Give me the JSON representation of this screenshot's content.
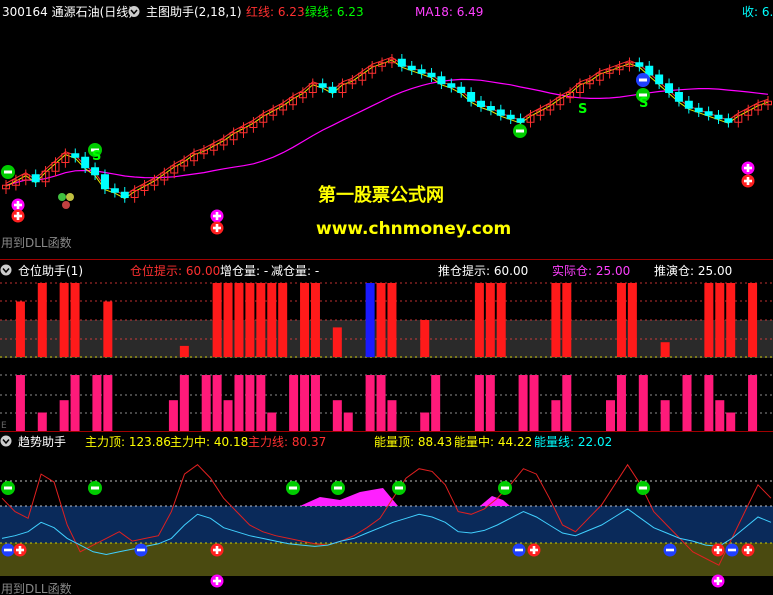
{
  "main": {
    "stock": "300164 通源石油(日线)",
    "indicator": "主图助手(2,18,1)",
    "red_line_label": "红线: 6.23",
    "green_line_label": "绿线: 6.23",
    "ma_label": "MA18: 6.49",
    "close_label": "收: 6.",
    "watermark_title": "第一股票公式网",
    "watermark_url": "www.chnmoney.com",
    "dll_note": "用到DLL函数",
    "signal_s": "S"
  },
  "panel2": {
    "title": "仓位助手(1)",
    "p1": "仓位提示: 60.00",
    "p2": "增仓量: -",
    "p3": "减仓量: -",
    "p4": "推仓提示: 60.00",
    "p5": "实际仓: 25.00",
    "p6": "推演仓: 25.00",
    "corner_char": "E"
  },
  "panel3": {
    "title": "趋势助手",
    "p1": "主力顶: 123.86",
    "p2": "主力中: 40.18",
    "p3": "主力线: 80.37",
    "p4": "能量顶: 88.43",
    "p5": "能量中: 44.22",
    "p6": "能量线: 22.02",
    "dll_note": "用到DLL函数"
  },
  "colors": {
    "up": "#ff3030",
    "down": "#00ffff",
    "ma": "#ff00ff",
    "green_line": "#e8e800",
    "bar_red": "#ff1a1a",
    "bar_pink": "#ff1a7a",
    "label_yellow": "#ffff00",
    "label_white": "#ffffff",
    "label_red": "#ff3030",
    "label_green": "#00ff00",
    "label_magenta": "#ff40ff",
    "label_cyan": "#00ffff"
  },
  "chart_data": [
    {
      "type": "candlestick",
      "note": "price panel, values estimated",
      "close": [
        6.02,
        6.05,
        6.08,
        6.04,
        6.1,
        6.15,
        6.2,
        6.18,
        6.12,
        6.08,
        6.0,
        5.98,
        5.95,
        5.99,
        6.02,
        6.05,
        6.09,
        6.13,
        6.16,
        6.2,
        6.22,
        6.25,
        6.28,
        6.32,
        6.35,
        6.38,
        6.42,
        6.45,
        6.48,
        6.52,
        6.55,
        6.6,
        6.58,
        6.55,
        6.6,
        6.62,
        6.66,
        6.7,
        6.72,
        6.74,
        6.7,
        6.68,
        6.66,
        6.64,
        6.6,
        6.58,
        6.55,
        6.5,
        6.47,
        6.45,
        6.42,
        6.4,
        6.38,
        6.42,
        6.45,
        6.48,
        6.52,
        6.55,
        6.6,
        6.62,
        6.66,
        6.68,
        6.7,
        6.72,
        6.7,
        6.65,
        6.6,
        6.55,
        6.5,
        6.46,
        6.44,
        6.42,
        6.4,
        6.38,
        6.42,
        6.45,
        6.48,
        6.5
      ]
    },
    {
      "type": "bar",
      "name": "仓位",
      "values": [
        0,
        75,
        0,
        100,
        0,
        100,
        100,
        0,
        0,
        75,
        0,
        0,
        0,
        0,
        0,
        0,
        15,
        0,
        0,
        100,
        100,
        100,
        100,
        100,
        100,
        100,
        0,
        100,
        100,
        0,
        40,
        0,
        0,
        100,
        100,
        100,
        0,
        0,
        50,
        0,
        0,
        0,
        0,
        100,
        100,
        100,
        0,
        0,
        0,
        0,
        100,
        100,
        0,
        0,
        0,
        0,
        100,
        100,
        0,
        0,
        20,
        0,
        0,
        0,
        100,
        100,
        100,
        0,
        100,
        0
      ],
      "pink_values": [
        0,
        100,
        0,
        100,
        0,
        100,
        100,
        0,
        100,
        100,
        0,
        0,
        0,
        0,
        0,
        100,
        100,
        0,
        100,
        100,
        100,
        100,
        100,
        100,
        100,
        0,
        100,
        100,
        100,
        0,
        100,
        100,
        0,
        100,
        100,
        100,
        0,
        0,
        100,
        100,
        0,
        0,
        0,
        100,
        100,
        0,
        0,
        100,
        100,
        0,
        100,
        100,
        0,
        0,
        0,
        100,
        100,
        0,
        100,
        0,
        100,
        0,
        100,
        0,
        100,
        100,
        100,
        0,
        100,
        0
      ]
    },
    {
      "type": "line",
      "series": [
        {
          "name": "主力线",
          "values": [
            70,
            60,
            55,
            88,
            82,
            50,
            30,
            35,
            40,
            45,
            38,
            40,
            42,
            60,
            88,
            95,
            85,
            70,
            60,
            50,
            45,
            42,
            40,
            38,
            36,
            35,
            38,
            42,
            48,
            55,
            70,
            85,
            92,
            90,
            80,
            60,
            58,
            62,
            70,
            80,
            92,
            88,
            70,
            50,
            45,
            55,
            65,
            80,
            95,
            80,
            60,
            50,
            40,
            30,
            25,
            20,
            40,
            60,
            80,
            70
          ]
        },
        {
          "name": "能量线",
          "values": [
            40,
            42,
            45,
            52,
            48,
            40,
            35,
            30,
            28,
            30,
            32,
            34,
            36,
            40,
            50,
            58,
            55,
            48,
            45,
            42,
            40,
            38,
            36,
            35,
            34,
            35,
            38,
            40,
            44,
            48,
            52,
            55,
            58,
            56,
            52,
            45,
            44,
            46,
            50,
            55,
            60,
            56,
            50,
            44,
            42,
            46,
            50,
            56,
            62,
            55,
            48,
            44,
            40,
            38,
            35,
            34,
            40,
            48,
            56,
            52
          ]
        }
      ]
    }
  ]
}
